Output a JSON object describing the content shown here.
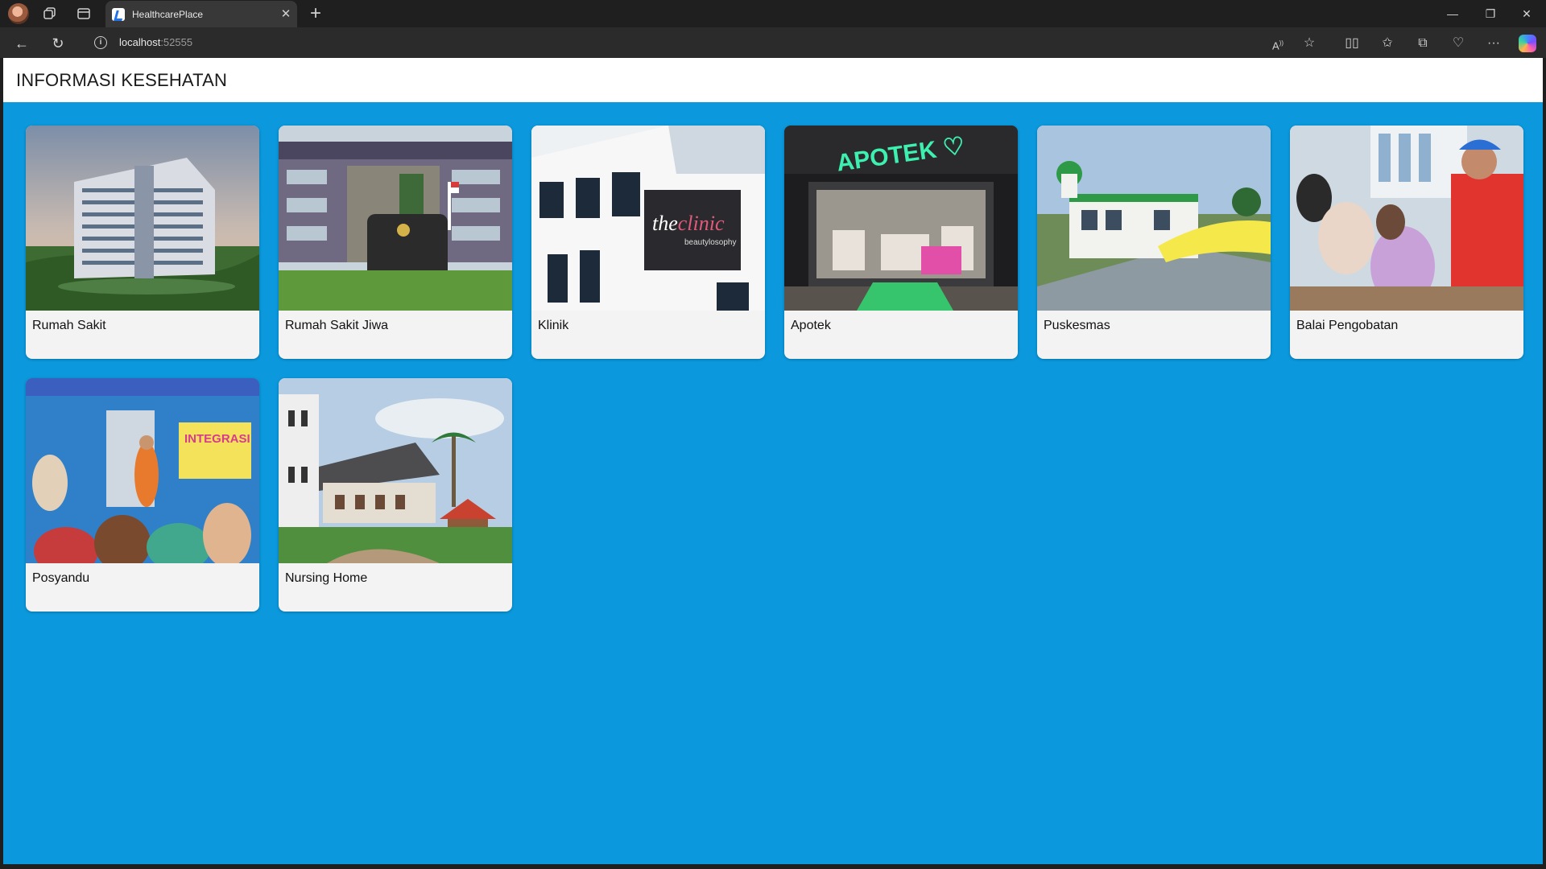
{
  "browser": {
    "tab_title": "HealthcarePlace",
    "url_host": "localhost",
    "url_port": ":52555"
  },
  "page": {
    "title": "INFORMASI KESEHATAN"
  },
  "cards": [
    {
      "label": "Rumah Sakit"
    },
    {
      "label": "Rumah Sakit Jiwa"
    },
    {
      "label": "Klinik",
      "image_text": "theclinic",
      "image_subtext": "beautylosophy"
    },
    {
      "label": "Apotek",
      "image_text": "APOTEK"
    },
    {
      "label": "Puskesmas"
    },
    {
      "label": "Balai Pengobatan"
    },
    {
      "label": "Posyandu",
      "image_text": "INTEGRASI"
    },
    {
      "label": "Nursing Home"
    }
  ],
  "colors": {
    "page_background": "#0b98dc",
    "card_background": "#f3f3f3",
    "appbar_background": "#ffffff"
  },
  "icons": {
    "back": "back-arrow-icon",
    "refresh": "refresh-icon",
    "site_info": "info-icon",
    "favorite": "star-icon"
  }
}
